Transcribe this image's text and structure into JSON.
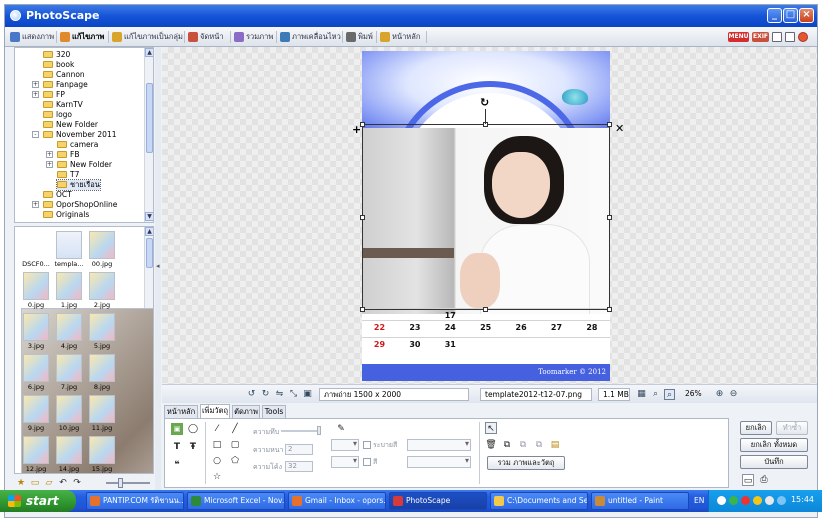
{
  "window": {
    "title": "PhotoScape"
  },
  "top_tabs": [
    {
      "label": "แสดงภาพ",
      "color": "#4a78c8"
    },
    {
      "label": "แก้ไขภาพ",
      "color": "#e08a2c",
      "active": true
    },
    {
      "label": "แก้ไขภาพเป็นกลุ่ม",
      "color": "#d9a42b"
    },
    {
      "label": "จัดหน้า",
      "color": "#c8503c"
    },
    {
      "label": "รวมภาพ",
      "color": "#8a6bc6"
    },
    {
      "label": "ภาพเคลื่อนไหว",
      "color": "#3c7bb8"
    },
    {
      "label": "พิมพ์",
      "color": "#6a6a6a"
    },
    {
      "label": "หน้าหลัก",
      "color": "#d9a42b"
    }
  ],
  "top_right": {
    "menu_label": "MENU",
    "exif_label": "EXIF"
  },
  "folder_tree": [
    {
      "label": "320",
      "depth": 1
    },
    {
      "label": "book",
      "depth": 1
    },
    {
      "label": "Cannon",
      "depth": 1
    },
    {
      "label": "Fanpage",
      "depth": 1,
      "expander": "+"
    },
    {
      "label": "FP",
      "depth": 1,
      "expander": "+"
    },
    {
      "label": "KarnTV",
      "depth": 1
    },
    {
      "label": "logo",
      "depth": 1
    },
    {
      "label": "New Folder",
      "depth": 1
    },
    {
      "label": "November 2011",
      "depth": 1,
      "expander": "-"
    },
    {
      "label": "camera",
      "depth": 2
    },
    {
      "label": "FB",
      "depth": 2,
      "expander": "+"
    },
    {
      "label": "New Folder",
      "depth": 2,
      "expander": "+"
    },
    {
      "label": "T7",
      "depth": 2
    },
    {
      "label": "ชายเรือน",
      "depth": 2,
      "selected": true
    },
    {
      "label": "OCT",
      "depth": 1
    },
    {
      "label": "OporShopOnline",
      "depth": 1,
      "expander": "+"
    },
    {
      "label": "Originals",
      "depth": 1
    }
  ],
  "thumbnails": [
    {
      "label": "DSCF0...",
      "kind": "photo"
    },
    {
      "label": "templa...",
      "kind": "white"
    },
    {
      "label": "00.jpg",
      "kind": "color"
    },
    {
      "label": "0.jpg",
      "kind": "color"
    },
    {
      "label": "1.jpg",
      "kind": "color"
    },
    {
      "label": "2.jpg",
      "kind": "color"
    },
    {
      "label": "3.jpg",
      "kind": "color"
    },
    {
      "label": "4.jpg",
      "kind": "color"
    },
    {
      "label": "5.jpg",
      "kind": "color"
    },
    {
      "label": "6.jpg",
      "kind": "color"
    },
    {
      "label": "7.jpg",
      "kind": "color"
    },
    {
      "label": "8.jpg",
      "kind": "color"
    },
    {
      "label": "9.jpg",
      "kind": "color"
    },
    {
      "label": "10.jpg",
      "kind": "color"
    },
    {
      "label": "11.jpg",
      "kind": "color"
    },
    {
      "label": "12.jpg",
      "kind": "color"
    },
    {
      "label": "14.jpg",
      "kind": "color"
    },
    {
      "label": "15.jpg",
      "kind": "color"
    }
  ],
  "calendar": {
    "partial_row": [
      "",
      "",
      "17",
      "",
      "",
      "",
      ""
    ],
    "rows": [
      [
        "22",
        "23",
        "24",
        "25",
        "26",
        "27",
        "28"
      ],
      [
        "29",
        "30",
        "31",
        "",
        "",
        "",
        ""
      ]
    ],
    "footer": "Toomarker © 2012"
  },
  "status": {
    "photo_size": "ภาพถ่าย 1500 x 2000",
    "filename": "template2012-t12-07.png",
    "filesize": "1.1 MB",
    "zoom": "26%"
  },
  "panel_tabs": [
    {
      "label": "หน้าหลัก"
    },
    {
      "label": "เพิ่มวัตถุ",
      "active": true
    },
    {
      "label": "ตัดภาพ"
    },
    {
      "label": "Tools"
    }
  ],
  "object_panel": {
    "opacity_label": "ความทึบ",
    "thickness_label": "ความหนา",
    "thickness_value": "2",
    "roundness_label": "ความโค้ง",
    "roundness_value": "32",
    "fill_label": "ระบายสี",
    "color_label": "สี",
    "merge_button": "รวม ภาพและวัตถุ"
  },
  "right_buttons": {
    "undo": "ยกเลิก",
    "redo": "ทำซ้ำ",
    "undo_all": "ยกเลิก ทั้งหมด",
    "save": "บันทึก"
  },
  "taskbar": {
    "start": "start",
    "tasks": [
      {
        "label": "PANTIP.COM รัติชานน...",
        "color": "#e6712c"
      },
      {
        "label": "Microsoft Excel - Nov...",
        "color": "#2d8a3a"
      },
      {
        "label": "Gmail - Inbox - opors...",
        "color": "#e6712c"
      },
      {
        "label": "PhotoScape",
        "color": "#d63b3b",
        "active": true
      },
      {
        "label": "C:\\Documents and Se...",
        "color": "#f2c94c"
      },
      {
        "label": "untitled - Paint",
        "color": "#c98a3a"
      }
    ],
    "lang": "EN",
    "time": "15:44"
  }
}
